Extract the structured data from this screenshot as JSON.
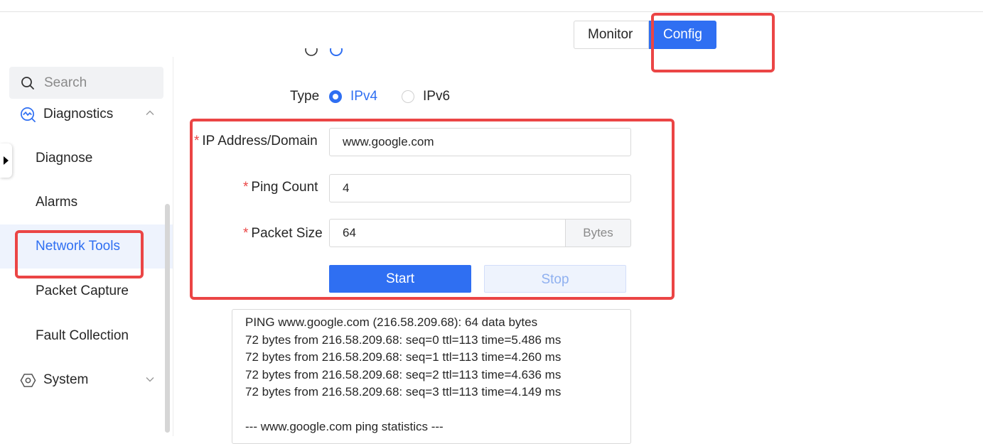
{
  "header": {
    "mode_tabs": [
      {
        "label": "Monitor",
        "active": false
      },
      {
        "label": "Config",
        "active": true
      }
    ]
  },
  "sidebar": {
    "search_placeholder": "Search",
    "groups": [
      {
        "label": "Diagnostics",
        "icon": "diagnostics-icon",
        "expanded": true
      },
      {
        "label": "System",
        "icon": "system-hexagon-icon",
        "expanded": false
      }
    ],
    "items": [
      {
        "label": "Diagnose",
        "active": false
      },
      {
        "label": "Alarms",
        "active": false
      },
      {
        "label": "Network Tools",
        "active": true
      },
      {
        "label": "Packet Capture",
        "active": false
      },
      {
        "label": "Fault Collection",
        "active": false
      }
    ]
  },
  "form": {
    "type_label": "Type",
    "type_options": [
      {
        "label": "IPv4",
        "selected": true
      },
      {
        "label": "IPv6",
        "selected": false
      }
    ],
    "ip_label": "IP Address/Domain",
    "ip_value": "www.google.com",
    "ping_count_label": "Ping Count",
    "ping_count_value": "4",
    "packet_size_label": "Packet Size",
    "packet_size_value": "64",
    "packet_size_unit": "Bytes",
    "required_mark": "*",
    "start_label": "Start",
    "stop_label": "Stop"
  },
  "output": {
    "lines": [
      "PING www.google.com (216.58.209.68): 64 data bytes",
      "72 bytes from 216.58.209.68: seq=0 ttl=113 time=5.486 ms",
      "72 bytes from 216.58.209.68: seq=1 ttl=113 time=4.260 ms",
      "72 bytes from 216.58.209.68: seq=2 ttl=113 time=4.636 ms",
      "72 bytes from 216.58.209.68: seq=3 ttl=113 time=4.149 ms",
      "",
      "--- www.google.com ping statistics ---"
    ]
  },
  "colors": {
    "accent": "#2f6ff2",
    "highlight": "#eb4545",
    "required": "#eb4545"
  }
}
